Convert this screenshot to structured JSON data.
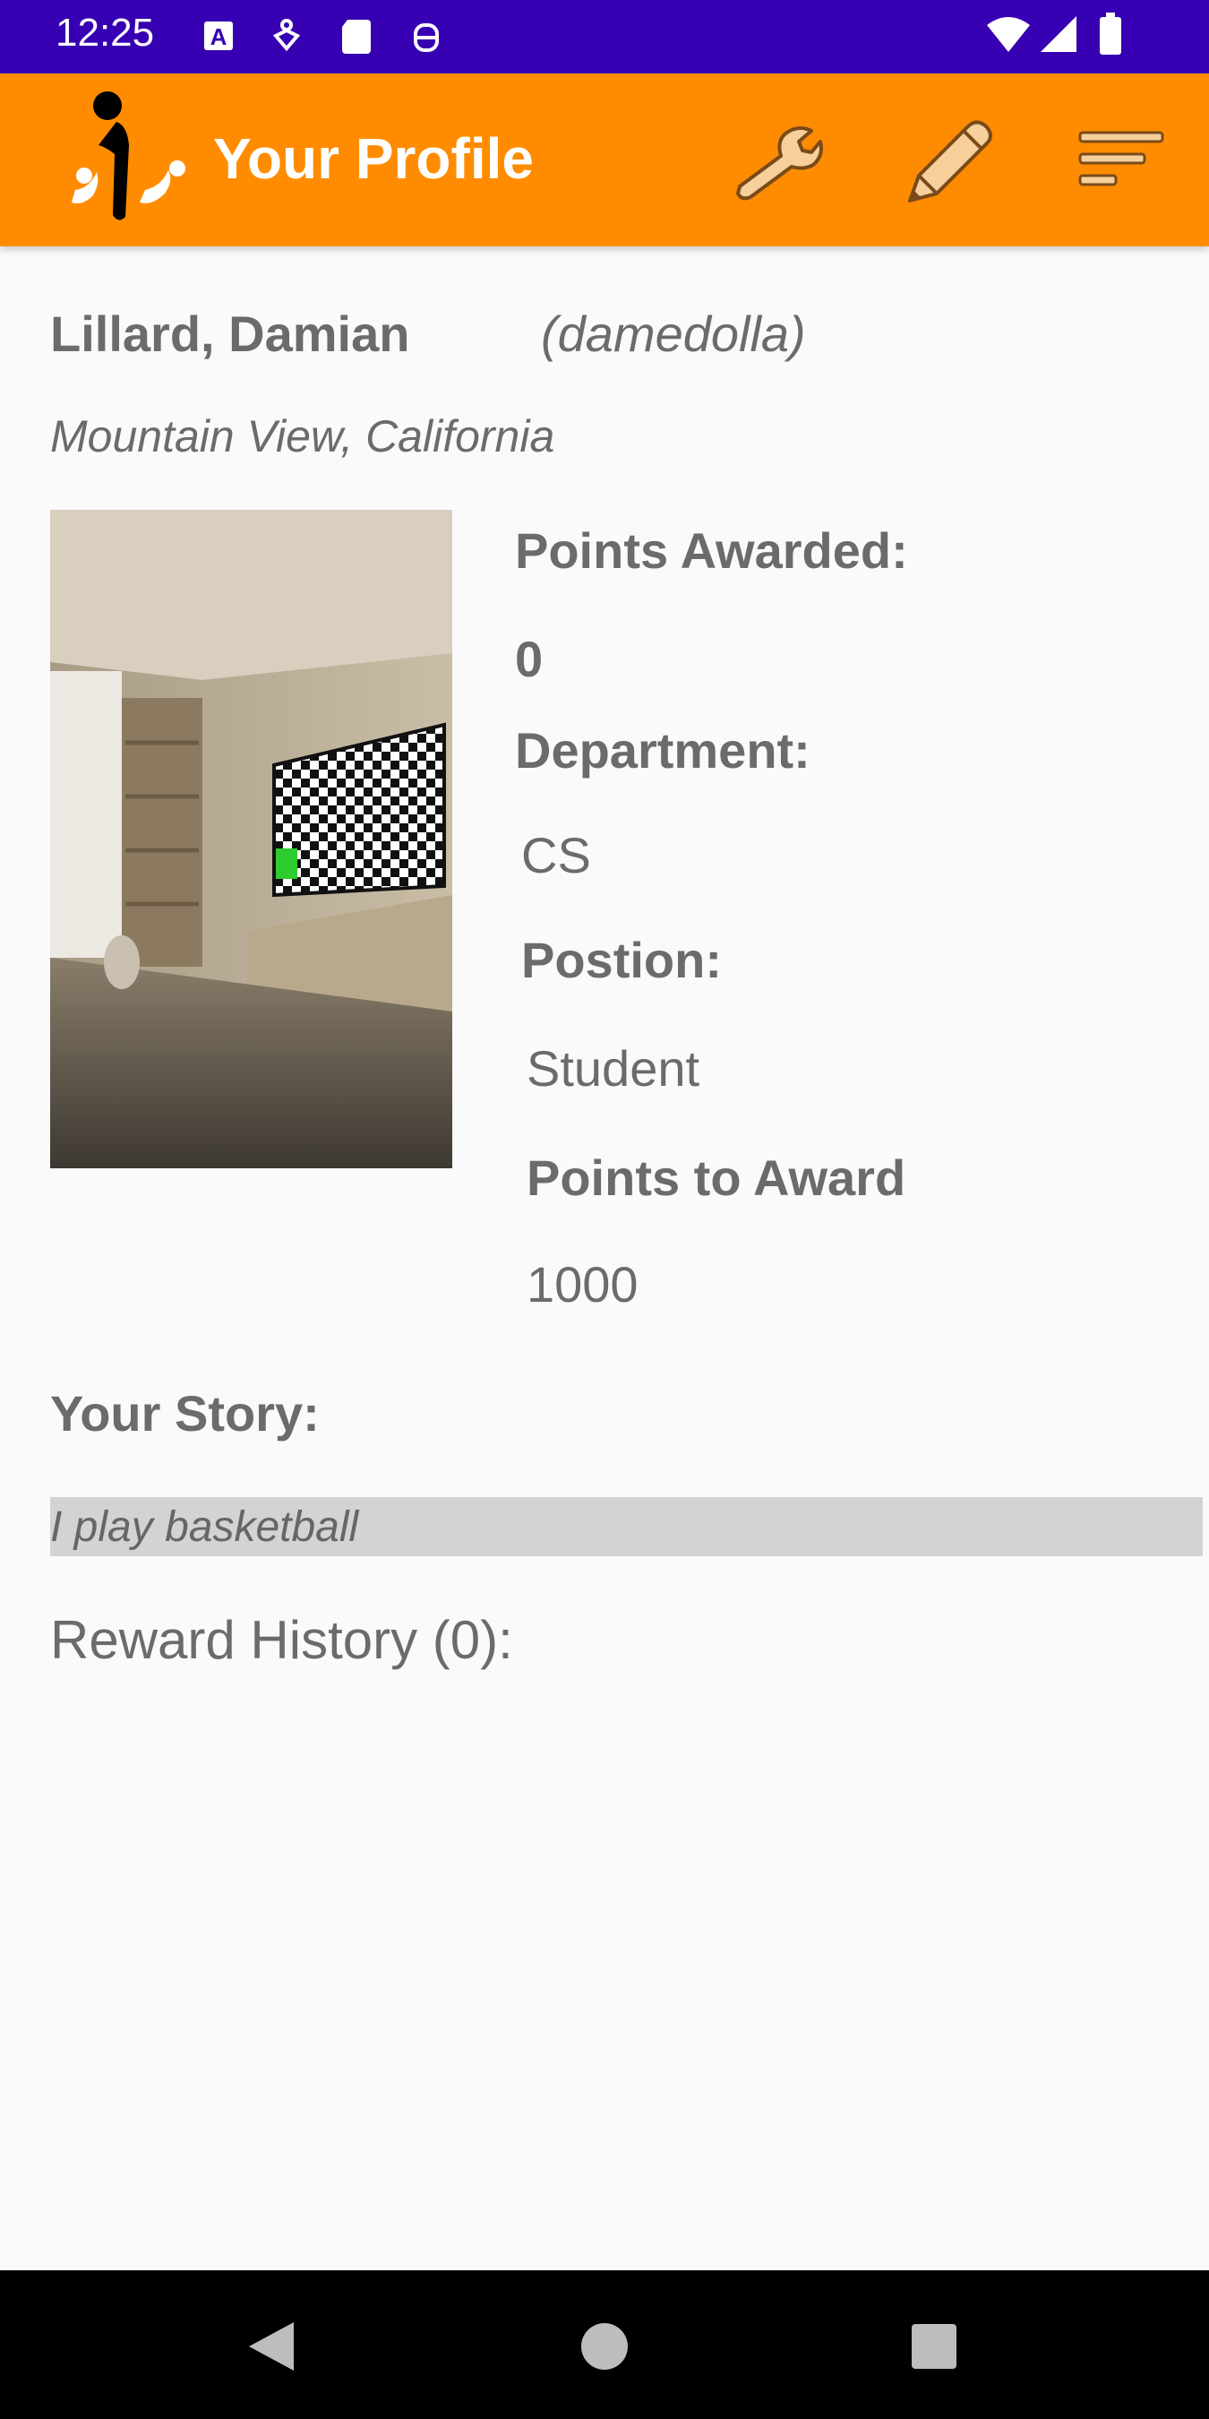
{
  "status_bar": {
    "time": "12:25",
    "left_icons": [
      "a-notification-icon",
      "accessibility-icon",
      "sd-card-icon",
      "debug-icon"
    ],
    "right_icons": [
      "wifi-icon",
      "cell-signal-icon",
      "battery-icon"
    ]
  },
  "app_bar": {
    "title": "Your Profile",
    "actions": [
      "wrench-icon",
      "pencil-icon",
      "sort-menu-icon"
    ]
  },
  "profile": {
    "name": "Lillard, Damian",
    "username": "(damedolla)",
    "location": "Mountain View, California",
    "points_awarded_label": "Points Awarded:",
    "points_awarded_value": "0",
    "department_label": "Department:",
    "department_value": "CS",
    "position_label": "Postion:",
    "position_value": "Student",
    "points_to_award_label": "Points to Award",
    "points_to_award_value": "1000",
    "story_label": "Your Story:",
    "story_text": "I play basketball",
    "reward_history": "Reward History (0):"
  },
  "colors": {
    "status_bar": "#3700b3",
    "app_bar": "#ff8c00",
    "text": "#6b6b6b"
  }
}
